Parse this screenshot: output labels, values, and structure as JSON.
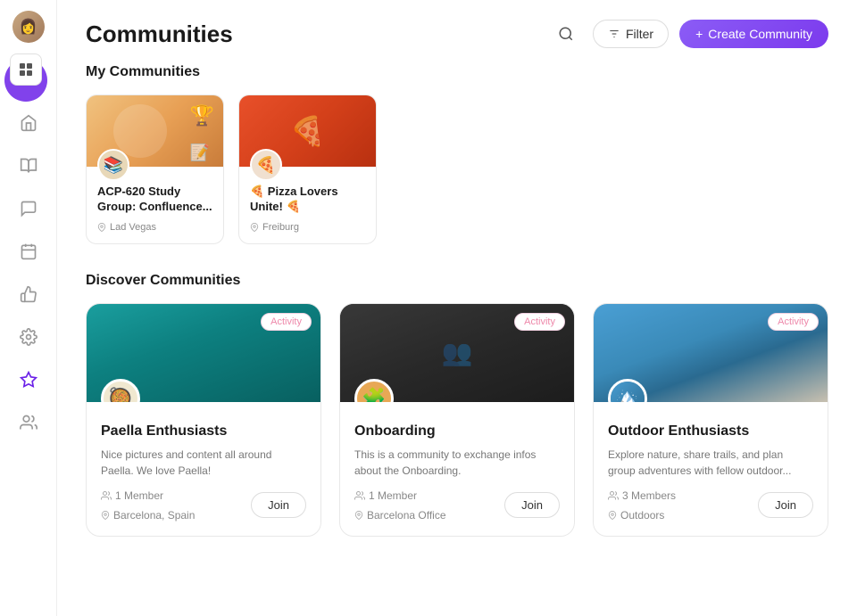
{
  "page": {
    "title": "Communities"
  },
  "header": {
    "title": "Communities",
    "filter_label": "Filter",
    "create_label": "Create Community",
    "create_prefix": "+"
  },
  "my_communities": {
    "section_title": "My Communities",
    "items": [
      {
        "id": "study-group",
        "name": "ACP-620 Study Group: Confluence...",
        "location": "Lad Vegas",
        "emoji": "📚",
        "img_type": "study"
      },
      {
        "id": "pizza-lovers",
        "name": "🍕 Pizza Lovers Unite! 🍕",
        "location": "Freiburg",
        "emoji": "🍕",
        "img_type": "pizza"
      }
    ]
  },
  "discover_communities": {
    "section_title": "Discover Communities",
    "items": [
      {
        "id": "paella",
        "name": "Paella Enthusiasts",
        "description": "Nice pictures and content all around Paella. We love Paella!",
        "members": "1 Member",
        "location": "Barcelona, Spain",
        "badge": "Activity",
        "img_type": "paella",
        "avatar_emoji": "🥘"
      },
      {
        "id": "onboarding",
        "name": "Onboarding",
        "description": "This is a community to exchange infos about the Onboarding.",
        "members": "1 Member",
        "location": "Barcelona Office",
        "badge": "Activity",
        "img_type": "onboarding",
        "avatar_emoji": "🧩"
      },
      {
        "id": "outdoor",
        "name": "Outdoor Enthusiasts",
        "description": "Explore nature, share trails, and plan group adventures with fellow outdoor...",
        "members": "3 Members",
        "location": "Outdoors",
        "badge": "Activity",
        "img_type": "outdoor",
        "avatar_emoji": "🏔️"
      }
    ]
  },
  "sidebar": {
    "items": [
      {
        "id": "home",
        "icon": "🏠",
        "label": "Home"
      },
      {
        "id": "library",
        "icon": "📖",
        "label": "Library"
      },
      {
        "id": "messages",
        "icon": "💬",
        "label": "Messages"
      },
      {
        "id": "calendar",
        "icon": "📅",
        "label": "Calendar"
      },
      {
        "id": "like",
        "icon": "👍",
        "label": "Like"
      },
      {
        "id": "settings",
        "icon": "⚙️",
        "label": "Settings"
      },
      {
        "id": "explore",
        "icon": "🚀",
        "label": "Explore",
        "active": true
      },
      {
        "id": "community",
        "icon": "👥",
        "label": "Community"
      }
    ]
  },
  "join_button_label": "Join"
}
